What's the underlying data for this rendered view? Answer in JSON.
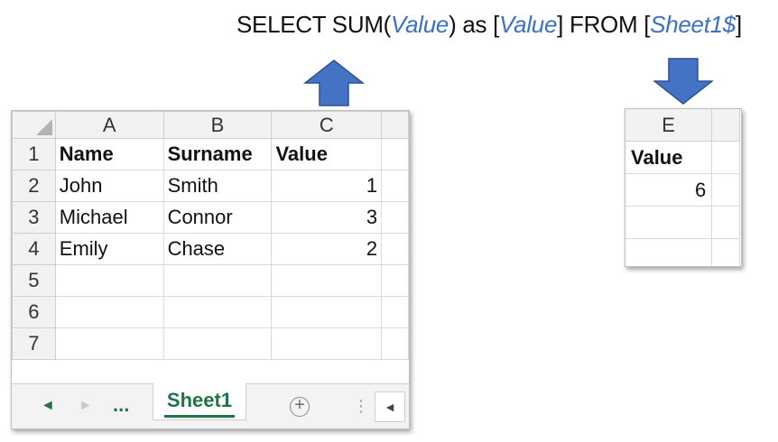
{
  "sql": {
    "select_sum": "SELECT SUM(",
    "field": "Value",
    "as_open": ") as [",
    "alias": "Value",
    "from_open": "] FROM [",
    "table": "Sheet1$",
    "close": "]"
  },
  "colors": {
    "arrow": "#4472c4",
    "identifier": "#3d6fc2",
    "excel_green": "#217346"
  },
  "icons": {
    "arrow_up": "arrow-up-icon",
    "arrow_down": "arrow-down-icon",
    "add": "plus-circle-icon"
  },
  "sheet": {
    "columns": [
      "A",
      "B",
      "C"
    ],
    "rows": [
      {
        "num": "1",
        "cells": [
          "Name",
          "Surname",
          "Value"
        ]
      },
      {
        "num": "2",
        "cells": [
          "John",
          "Smith",
          "1"
        ]
      },
      {
        "num": "3",
        "cells": [
          "Michael",
          "Connor",
          "3"
        ]
      },
      {
        "num": "4",
        "cells": [
          "Emily",
          "Chase",
          "2"
        ]
      },
      {
        "num": "5",
        "cells": [
          "",
          "",
          ""
        ]
      },
      {
        "num": "6",
        "cells": [
          "",
          "",
          ""
        ]
      },
      {
        "num": "7",
        "cells": [
          "",
          "",
          ""
        ]
      }
    ],
    "tabs": {
      "prev": "◄",
      "next": "►",
      "ellipsis": "...",
      "active": "Sheet1",
      "add": "+",
      "separator": "⋮",
      "scroll_left": "◄"
    }
  },
  "result": {
    "column": "E",
    "header": "Value",
    "value": "6"
  }
}
